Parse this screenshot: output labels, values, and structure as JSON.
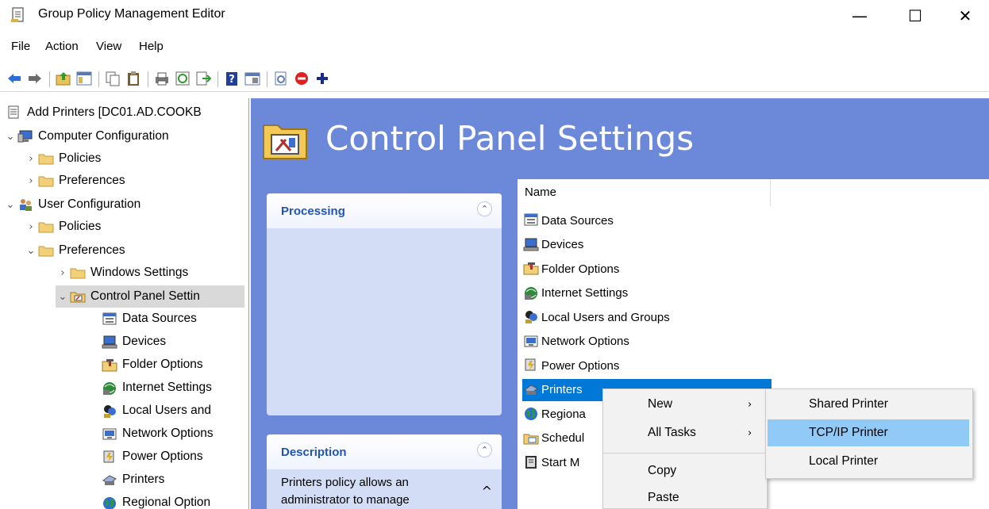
{
  "window": {
    "title": "Group Policy Management Editor",
    "controls": {
      "minimize": "—",
      "maximize": "☐",
      "close": "✕"
    }
  },
  "menu": {
    "items": [
      "File",
      "Action",
      "View",
      "Help"
    ]
  },
  "toolbar": {
    "buttons": [
      "back-icon",
      "forward-icon",
      "up-folder-icon",
      "show-hide-tree-icon",
      "copy-icon",
      "paste-icon",
      "print-icon",
      "refresh-icon",
      "export-list-icon",
      "help-icon",
      "properties-icon",
      "new-window-icon",
      "stop-icon",
      "add-icon"
    ]
  },
  "tree": {
    "root": "Add Printers [DC01.AD.COOKB",
    "computer_configuration": "Computer Configuration",
    "cc_policies": "Policies",
    "cc_preferences": "Preferences",
    "user_configuration": "User Configuration",
    "uc_policies": "Policies",
    "uc_preferences": "Preferences",
    "windows_settings": "Windows Settings",
    "control_panel_settings": "Control Panel Settin",
    "children": [
      "Data Sources",
      "Devices",
      "Folder Options",
      "Internet Settings",
      "Local Users and",
      "Network Options",
      "Power Options",
      "Printers",
      "Regional Option"
    ]
  },
  "main": {
    "header_title": "Control Panel Settings",
    "processing": {
      "title": "Processing"
    },
    "description": {
      "title": "Description",
      "text": "Printers policy allows an administrator to manage"
    },
    "list": {
      "column_name": "Name",
      "items": [
        "Data Sources",
        "Devices",
        "Folder Options",
        "Internet Settings",
        "Local Users and Groups",
        "Network Options",
        "Power Options",
        "Printers",
        "Regiona",
        "Schedul",
        "Start M"
      ],
      "selected": "Printers"
    }
  },
  "context_menu": {
    "items": [
      "New",
      "All Tasks",
      "Copy",
      "Paste"
    ],
    "submenu": [
      "Shared Printer",
      "TCP/IP Printer",
      "Local Printer"
    ],
    "highlighted_submenu": "TCP/IP Printer"
  }
}
